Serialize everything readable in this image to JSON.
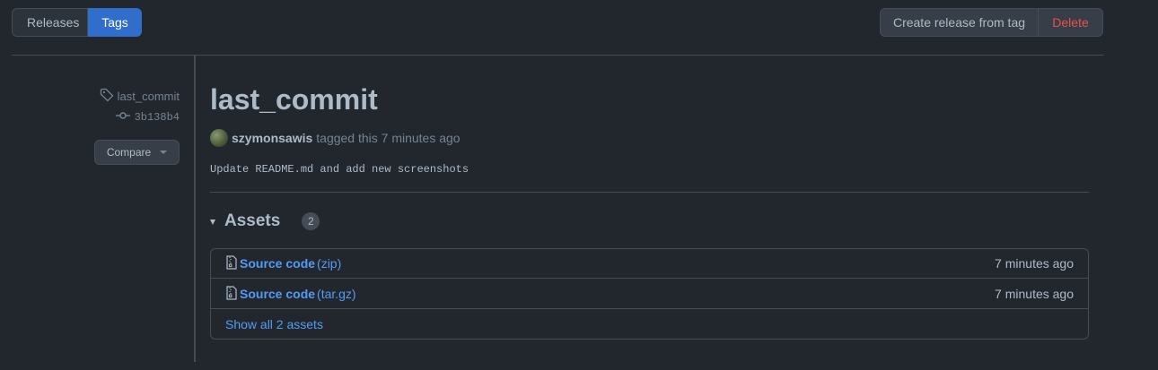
{
  "header": {
    "tabs": [
      {
        "label": "Releases",
        "active": false
      },
      {
        "label": "Tags",
        "active": true
      }
    ],
    "create_release_label": "Create release from tag",
    "delete_label": "Delete"
  },
  "sidebar": {
    "tag_icon": "tag-icon",
    "tag_name": "last_commit",
    "commit_icon": "git-commit-icon",
    "commit_sha": "3b138b4",
    "compare_label": "Compare"
  },
  "release": {
    "title": "last_commit",
    "author": "szymonsawis",
    "tagged_text": "tagged this 7 minutes ago",
    "message": "Update README.md and add new screenshots"
  },
  "assets": {
    "heading": "Assets",
    "count": "2",
    "items": [
      {
        "icon": "file-zip-icon",
        "name": "Source code",
        "ext": "(zip)",
        "time": "7 minutes ago"
      },
      {
        "icon": "file-zip-icon",
        "name": "Source code",
        "ext": "(tar.gz)",
        "time": "7 minutes ago"
      }
    ],
    "show_all": "Show all 2 assets"
  },
  "colors": {
    "background": "#22272e",
    "accent": "#316dca",
    "link": "#539bf5",
    "danger": "#e5534b"
  }
}
